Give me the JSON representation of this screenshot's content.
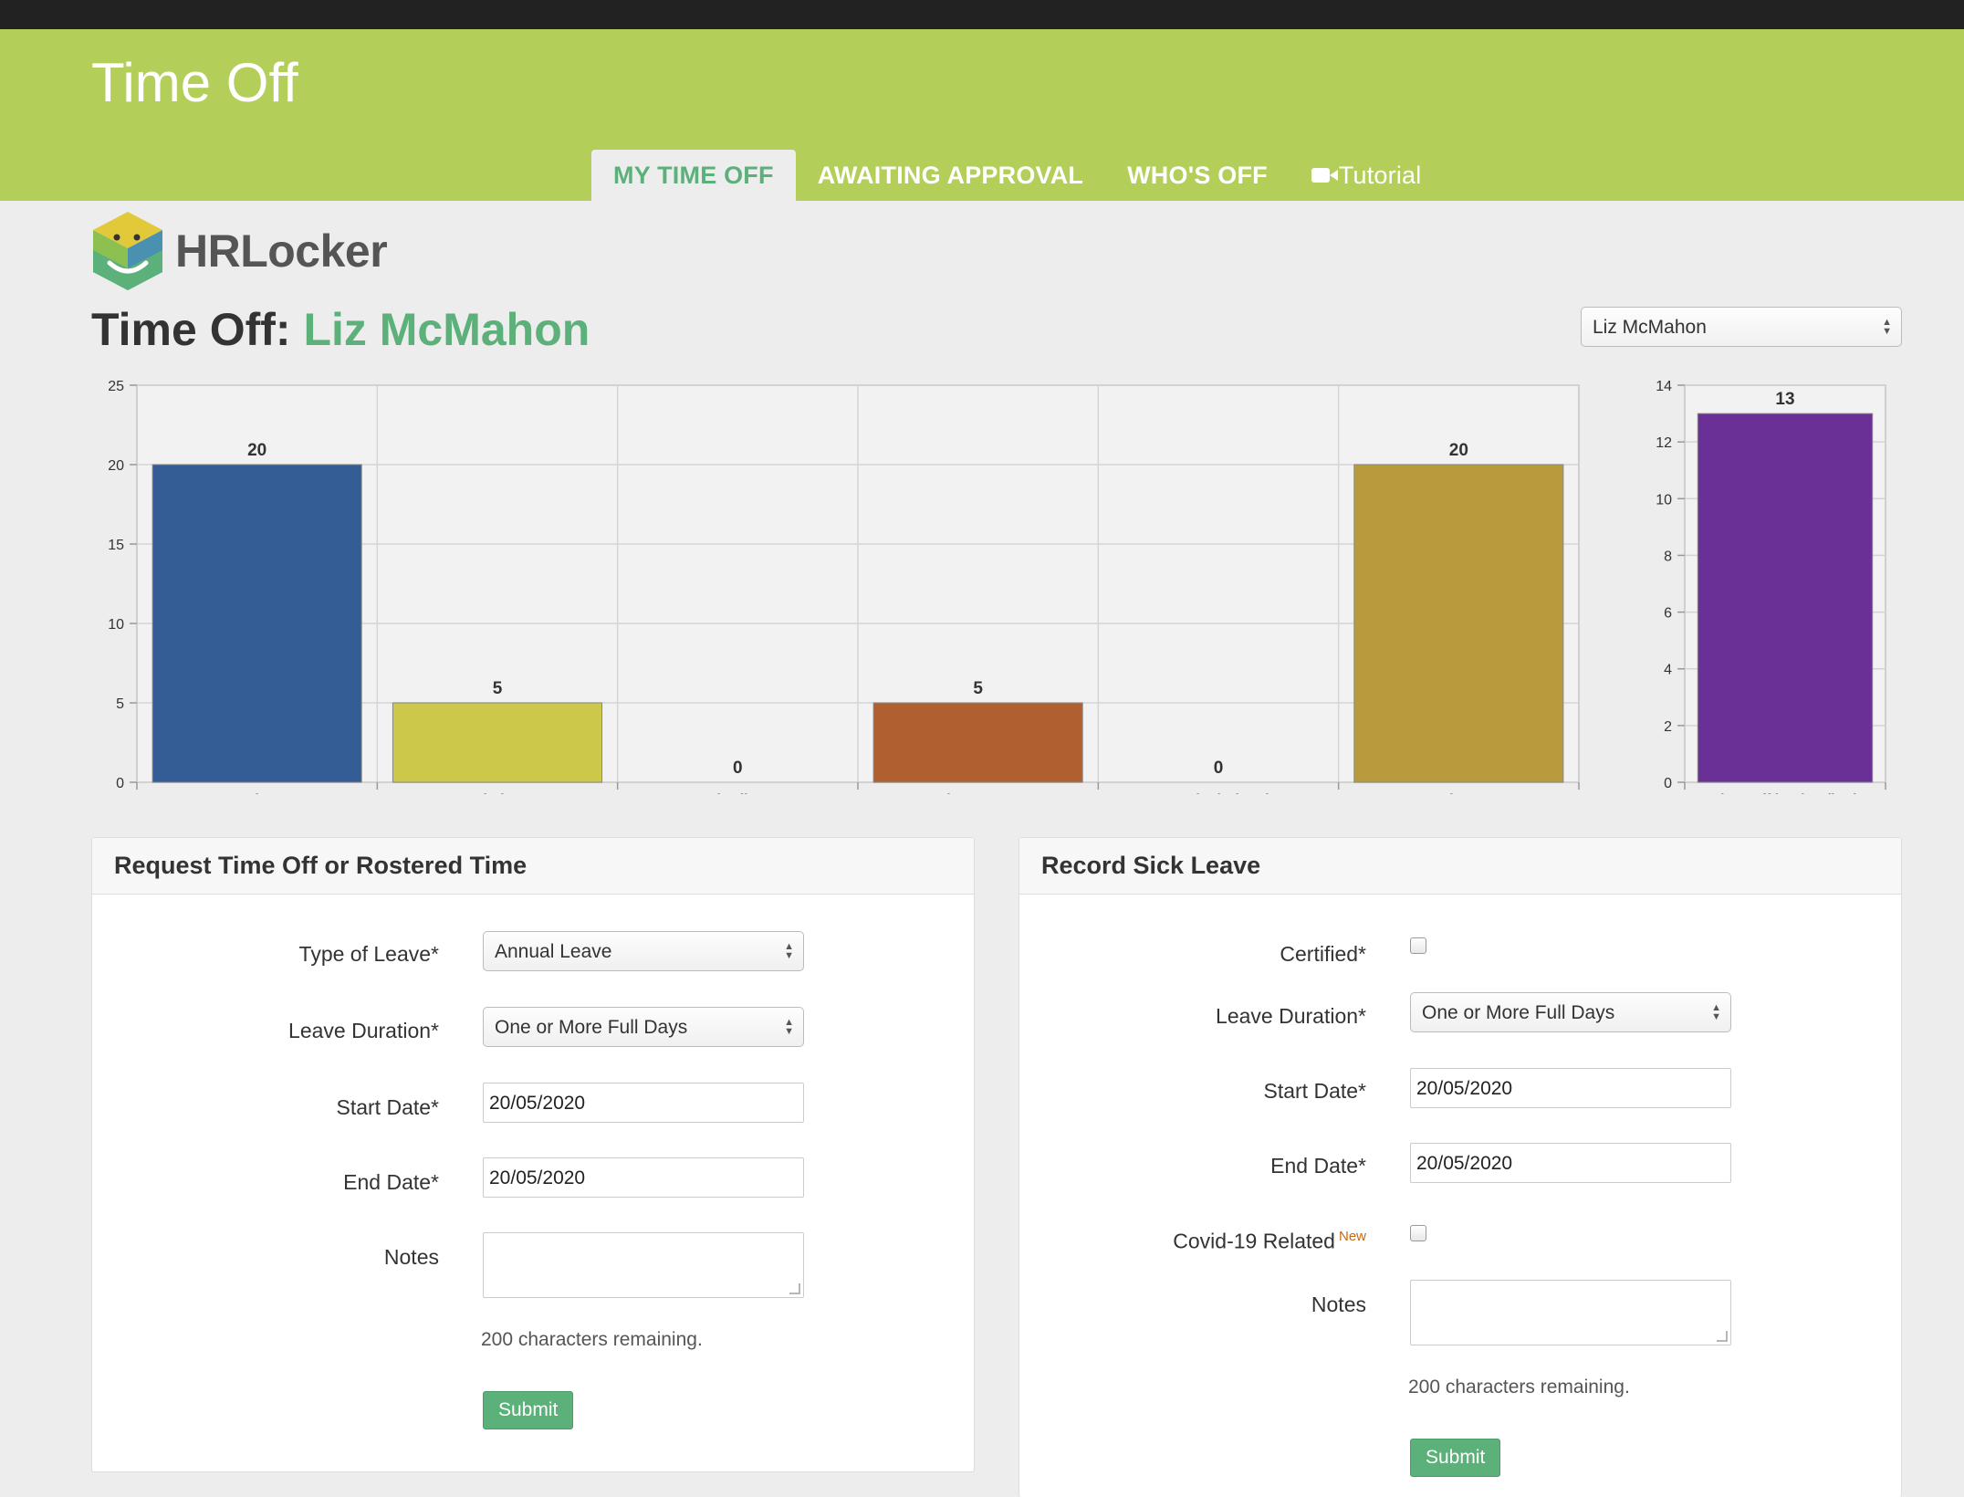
{
  "app": {
    "title": "Time Off"
  },
  "tabs": [
    {
      "label": "MY TIME OFF",
      "active": true
    },
    {
      "label": "AWAITING APPROVAL",
      "active": false
    },
    {
      "label": "WHO'S OFF",
      "active": false
    },
    {
      "label": "Tutorial",
      "icon": "video-camera-icon",
      "active": false
    }
  ],
  "brand": {
    "name": "HRLocker",
    "colors": {
      "green": "#5cb07a",
      "lime": "#b3cf5a"
    }
  },
  "page": {
    "title_prefix": "Time Off:",
    "employee_name": "Liz McMahon"
  },
  "employee_select": {
    "value": "Liz McMahon"
  },
  "chart_data": [
    {
      "type": "bar",
      "categories": [
        "Annual Leave",
        "Carried Over",
        "Manual Adjustment",
        "Taken to Date",
        "Booked Ahead",
        "Balance"
      ],
      "values": [
        20,
        5,
        0,
        5,
        0,
        20
      ],
      "colors": [
        "#345d96",
        "#cbc84a",
        "#888888",
        "#b06030",
        "#888888",
        "#b89b3c"
      ],
      "ylim": [
        0,
        25
      ],
      "yticks": [
        0,
        5,
        10,
        15,
        20,
        25
      ],
      "grid": true,
      "title": "",
      "xlabel": "",
      "ylabel": ""
    },
    {
      "type": "bar",
      "categories": [
        "Time Off in Lieu (hrs)"
      ],
      "values": [
        13
      ],
      "colors": [
        "#6a3096"
      ],
      "ylim": [
        0,
        14
      ],
      "yticks": [
        0,
        2,
        4,
        6,
        8,
        10,
        12,
        14
      ],
      "grid": true,
      "title": "",
      "xlabel": "",
      "ylabel": ""
    }
  ],
  "request_form": {
    "title": "Request Time Off or Rostered Time",
    "type_label": "Type of Leave*",
    "type_value": "Annual Leave",
    "duration_label": "Leave Duration*",
    "duration_value": "One or More Full Days",
    "start_label": "Start Date*",
    "start_value": "20/05/2020",
    "end_label": "End Date*",
    "end_value": "20/05/2020",
    "notes_label": "Notes",
    "remaining": "200 characters remaining.",
    "submit": "Submit"
  },
  "sick_form": {
    "title": "Record Sick Leave",
    "certified_label": "Certified*",
    "duration_label": "Leave Duration*",
    "duration_value": "One or More Full Days",
    "start_label": "Start Date*",
    "start_value": "20/05/2020",
    "end_label": "End Date*",
    "end_value": "20/05/2020",
    "covid_label": "Covid-19 Related",
    "covid_badge": "New",
    "notes_label": "Notes",
    "remaining": "200 characters remaining.",
    "submit": "Submit"
  }
}
